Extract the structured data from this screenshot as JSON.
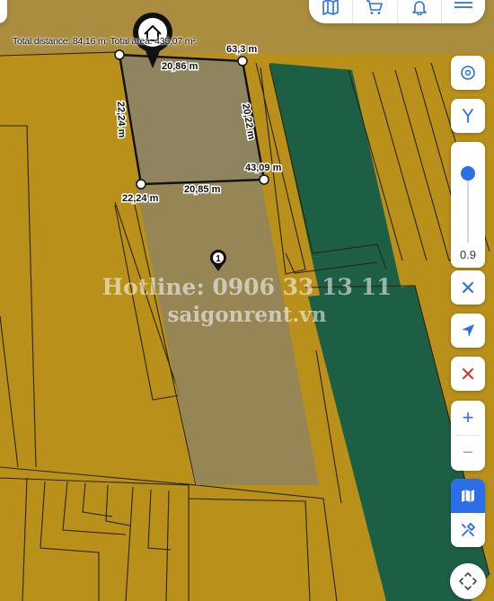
{
  "measurement": {
    "summary": "Total distance: 84,16 m; Total area: 435,07 m².",
    "edges": [
      {
        "label": "20,86 m"
      },
      {
        "label": "20,22 m"
      },
      {
        "label": "20,85 m"
      },
      {
        "label": "22,24 m"
      }
    ],
    "vertex_labels": [
      {
        "label": "63,3 m"
      },
      {
        "label": "43,09 m"
      },
      {
        "label": "22,24 m"
      }
    ]
  },
  "map": {
    "parcel_marker": "1",
    "home_marker_icon": "home-icon",
    "colors": {
      "land": "#b8901a",
      "land_alt": "#a98318",
      "green_zone": "#1d5f45",
      "parcel_lines": "#2b2410",
      "highlight": "#8f8460",
      "active_button": "#2b6ee8"
    }
  },
  "watermark": {
    "line1": "Hotline: 0906 33 13 11",
    "line2": "saigonrent.vn"
  },
  "toolbar": {
    "items": [
      {
        "icon": "map-book-icon"
      },
      {
        "icon": "cart-icon"
      },
      {
        "icon": "bell-icon"
      },
      {
        "icon": "menu-icon"
      }
    ]
  },
  "controls": {
    "opacity_value": "0.9",
    "opacity_fraction": 0.9,
    "zoom_in": "+",
    "zoom_out": "−",
    "icons": [
      "info-compass-icon",
      "fork-icon",
      "close-icon",
      "locate-arrow-icon",
      "clear-icon",
      "layers-map-icon",
      "tools-icon",
      "recenter-icon"
    ]
  }
}
